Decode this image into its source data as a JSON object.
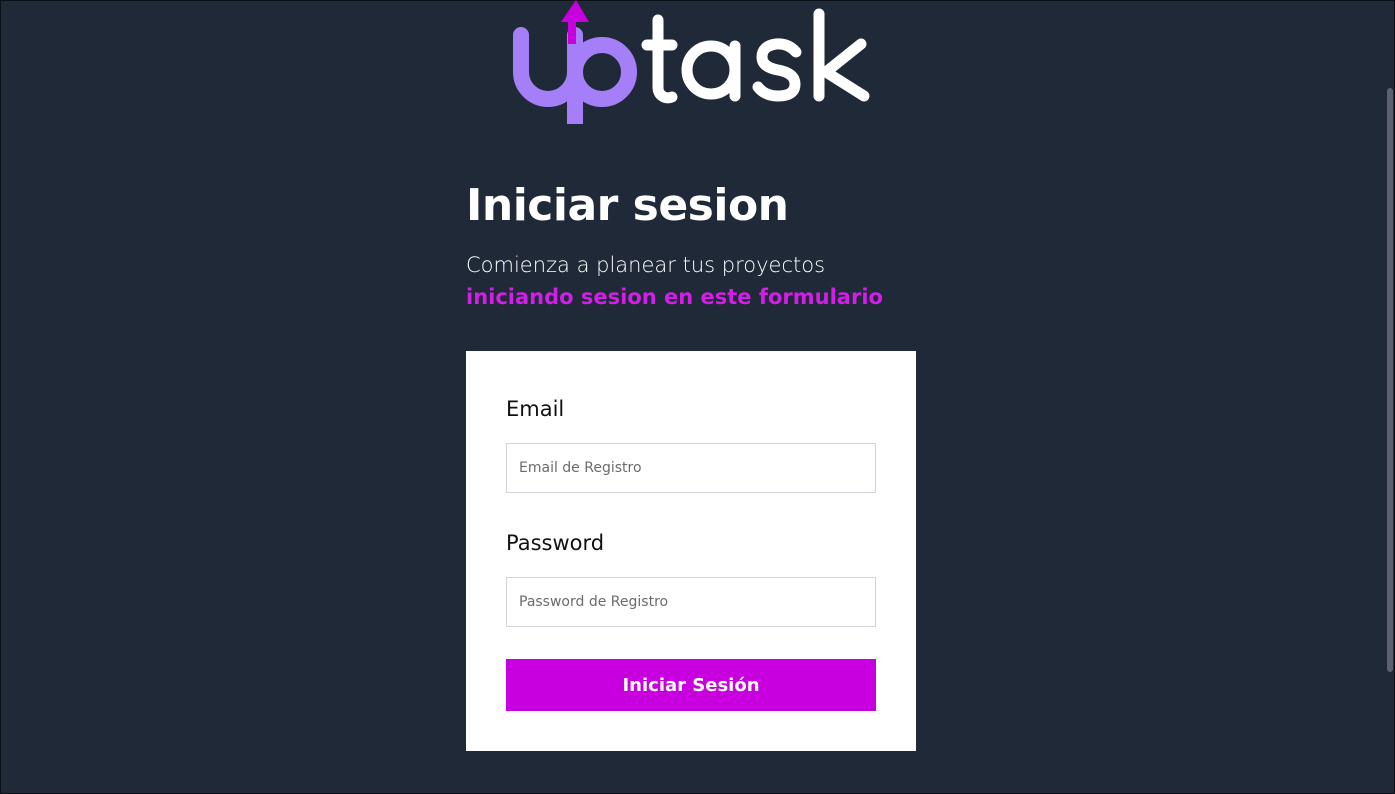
{
  "logo": {
    "text": "uptask",
    "brand_color": "#a47ff7",
    "arrow_color": "#c800e0"
  },
  "header": {
    "title": "Iniciar sesion",
    "subtitle": "Comienza a planear tus proyectos",
    "subtitle_accent": "iniciando sesion en este formulario"
  },
  "form": {
    "email_label": "Email",
    "email_placeholder": "Email de Registro",
    "email_value": "",
    "password_label": "Password",
    "password_placeholder": "Password de Registro",
    "password_value": "",
    "submit_label": "Iniciar Sesión"
  },
  "colors": {
    "background": "#1f2937",
    "accent": "#c800e0",
    "accent_text": "#d11fe6",
    "card": "#ffffff"
  }
}
